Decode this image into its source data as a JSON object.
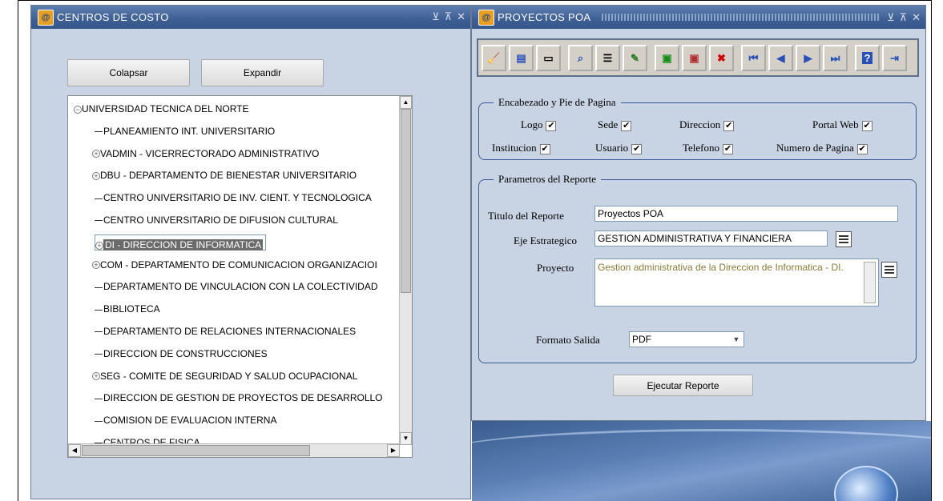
{
  "left_window": {
    "title": "CENTROS DE COSTO",
    "controls": [
      "⊻",
      "⊼",
      "✕"
    ],
    "collapse_label": "Colapsar",
    "expand_label": "Expandir",
    "tree": [
      {
        "label": "UNIVERSIDAD TECNICA DEL NORTE",
        "level": 0,
        "expandable": true,
        "expanded": true
      },
      {
        "label": "PLANEAMIENTO INT. UNIVERSITARIO",
        "level": 1,
        "expandable": false
      },
      {
        "label": "VADMIN - VICERRECTORADO ADMINISTRATIVO",
        "level": 1,
        "expandable": true
      },
      {
        "label": "DBU - DEPARTAMENTO DE BIENESTAR UNIVERSITARIO",
        "level": 1,
        "expandable": true
      },
      {
        "label": "CENTRO UNIVERSITARIO DE INV. CIENT. Y TECNOLOGICA",
        "level": 1,
        "expandable": false
      },
      {
        "label": "CENTRO UNIVERSITARIO DE DIFUSION CULTURAL",
        "level": 1,
        "expandable": false
      },
      {
        "label": "DI - DIRECCION DE INFORMATICA",
        "level": 1,
        "expandable": true,
        "selected": true
      },
      {
        "label": "COM - DEPARTAMENTO DE COMUNICACION ORGANIZACIOI",
        "level": 1,
        "expandable": true
      },
      {
        "label": "DEPARTAMENTO DE VINCULACION CON LA COLECTIVIDAD",
        "level": 1,
        "expandable": false
      },
      {
        "label": "BIBLIOTECA",
        "level": 1,
        "expandable": false
      },
      {
        "label": "DEPARTAMENTO DE RELACIONES INTERNACIONALES",
        "level": 1,
        "expandable": false
      },
      {
        "label": "DIRECCION DE CONSTRUCCIONES",
        "level": 1,
        "expandable": false
      },
      {
        "label": "SEG - COMITE DE SEGURIDAD Y SALUD OCUPACIONAL",
        "level": 1,
        "expandable": true
      },
      {
        "label": "DIRECCION DE GESTION DE PROYECTOS DE DESARROLLO",
        "level": 1,
        "expandable": false
      },
      {
        "label": "COMISION DE EVALUACION INTERNA",
        "level": 1,
        "expandable": false
      },
      {
        "label": "CENTROS DE FISICA",
        "level": 1,
        "expandable": false
      }
    ]
  },
  "right_window": {
    "title": "PROYECTOS POA",
    "controls": [
      "⊻",
      "⊼",
      "✕"
    ],
    "toolbar_icons": [
      "clear-icon",
      "save-icon",
      "print-icon",
      "search-icon",
      "list-icon",
      "edit-icon",
      "insert-record-icon",
      "edit-record-icon",
      "delete-record-icon",
      "first-record-icon",
      "previous-record-icon",
      "next-record-icon",
      "last-record-icon",
      "help-icon",
      "exit-icon"
    ],
    "header_section": {
      "legend": "Encabezado y Pie de Pagina",
      "checkboxes": [
        {
          "label": "Logo",
          "checked": true
        },
        {
          "label": "Sede",
          "checked": true
        },
        {
          "label": "Direccion",
          "checked": true
        },
        {
          "label": "Portal Web",
          "checked": true
        },
        {
          "label": "Institucion",
          "checked": true
        },
        {
          "label": "Usuario",
          "checked": true
        },
        {
          "label": "Telefono",
          "checked": true
        },
        {
          "label": "Numero de Pagina",
          "checked": true
        }
      ]
    },
    "params_section": {
      "legend": "Parametros del Reporte",
      "titulo_label": "Titulo del Reporte",
      "titulo_value": "Proyectos POA",
      "eje_label": "Eje Estrategico",
      "eje_value": "GESTION ADMINISTRATIVA Y FINANCIERA",
      "proyecto_label": "Proyecto",
      "proyecto_value": "Gestion administrativa de la Direccion de Informatica - DI.",
      "formato_label": "Formato Salida",
      "formato_value": "PDF"
    },
    "run_button": "Ejecutar Reporte"
  },
  "colors": {
    "titlebar": "#3d5f93",
    "window_bg": "#c8d3e3",
    "selected_node": "#6b6b6b",
    "fieldset_border": "#3b5a92"
  }
}
